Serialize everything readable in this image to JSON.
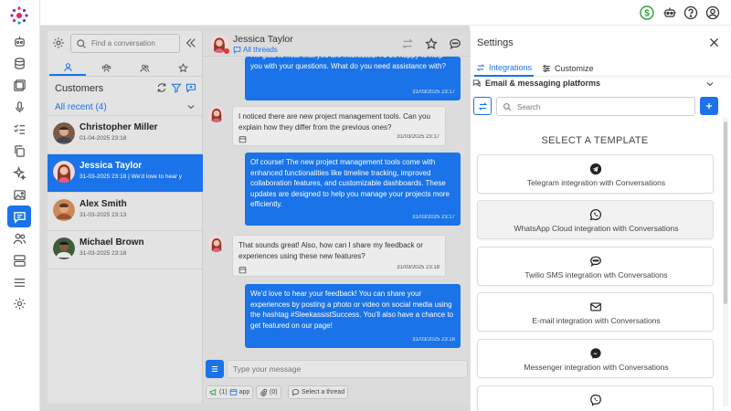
{
  "top_bar": {
    "icons": [
      "dollar-icon",
      "robot-icon",
      "help-icon",
      "user-icon"
    ],
    "colors": {
      "dollar": "#2e9e3e"
    }
  },
  "left_rail": {
    "items": [
      "bot-icon",
      "database-icon",
      "gallery-icon",
      "microphone-icon",
      "checklist-icon",
      "copy-icon",
      "sparkle-icon",
      "image-icon",
      "chat-icon",
      "users-icon",
      "server-icon",
      "menu-icon",
      "settings-icon"
    ],
    "active": "chat-icon"
  },
  "conversations": {
    "search_placeholder": "Find a conversation",
    "header": "Customers",
    "filter": "All recent (4)",
    "items": [
      {
        "name": "Christopher Miller",
        "sub": "01-04-2025 23:18"
      },
      {
        "name": "Jessica Taylor",
        "sub": "31-03-2025 23:18 | We'd love to hear y"
      },
      {
        "name": "Alex Smith",
        "sub": "31-03-2025 23:13"
      },
      {
        "name": "Michael Brown",
        "sub": "31-03-2025 23:18"
      }
    ]
  },
  "chat": {
    "contact_name": "Jessica Taylor",
    "threads_label": "All threads",
    "messages": [
      {
        "dir": "out",
        "text": "I'm glad to hear that you are interested. I'd be happy to help you with your questions. What do you need assistance with?",
        "time": "31/03/2025 23:17"
      },
      {
        "dir": "in",
        "text": "I noticed there are new project management tools. Can you explain how they differ from the previous ones?",
        "time": "31/03/2025 23:17"
      },
      {
        "dir": "out",
        "text": "Of course! The new project management tools come with enhanced functionalities like timeline tracking, improved collaboration features, and customizable dashboards. These updates are designed to help you manage your projects more efficiently.",
        "time": "31/03/2025 23:17"
      },
      {
        "dir": "in",
        "text": "That sounds great! Also, how can I share my feedback or experiences using these new features?",
        "time": "31/03/2025 23:18"
      },
      {
        "dir": "out",
        "text": "We'd love to hear your feedback! You can share your experiences by posting a photo or video on social media using the hashtag #SleekassistSuccess. You'll also have a chance to get featured on our page!",
        "time": "31/03/2025 23:18"
      }
    ],
    "composer_placeholder": "Type your message",
    "footer": {
      "channel_count": "(1)",
      "channel_label": "app",
      "attach_count": "(0)",
      "thread_label": "Select a thread"
    }
  },
  "settings": {
    "title": "Settings",
    "tabs": [
      "Integrations",
      "Customize"
    ],
    "active_tab": "Integrations",
    "section": "Email & messaging platforms",
    "search_placeholder": "Search",
    "select_title": "SELECT A TEMPLATE",
    "templates": [
      {
        "label": "Telegram integration with Conversations",
        "icon": "telegram-icon"
      },
      {
        "label": "WhatsApp Cloud integration with Conversations",
        "icon": "whatsapp-icon"
      },
      {
        "label": "Twilio SMS integration wth Conversations",
        "icon": "sms-icon"
      },
      {
        "label": "E-mail integration with Conversations",
        "icon": "mail-icon"
      },
      {
        "label": "Messenger integration with Conversations",
        "icon": "messenger-icon"
      },
      {
        "label": "",
        "icon": "viber-icon"
      }
    ]
  },
  "colors": {
    "accent": "#1a73e8",
    "status_red": "#e53935"
  }
}
